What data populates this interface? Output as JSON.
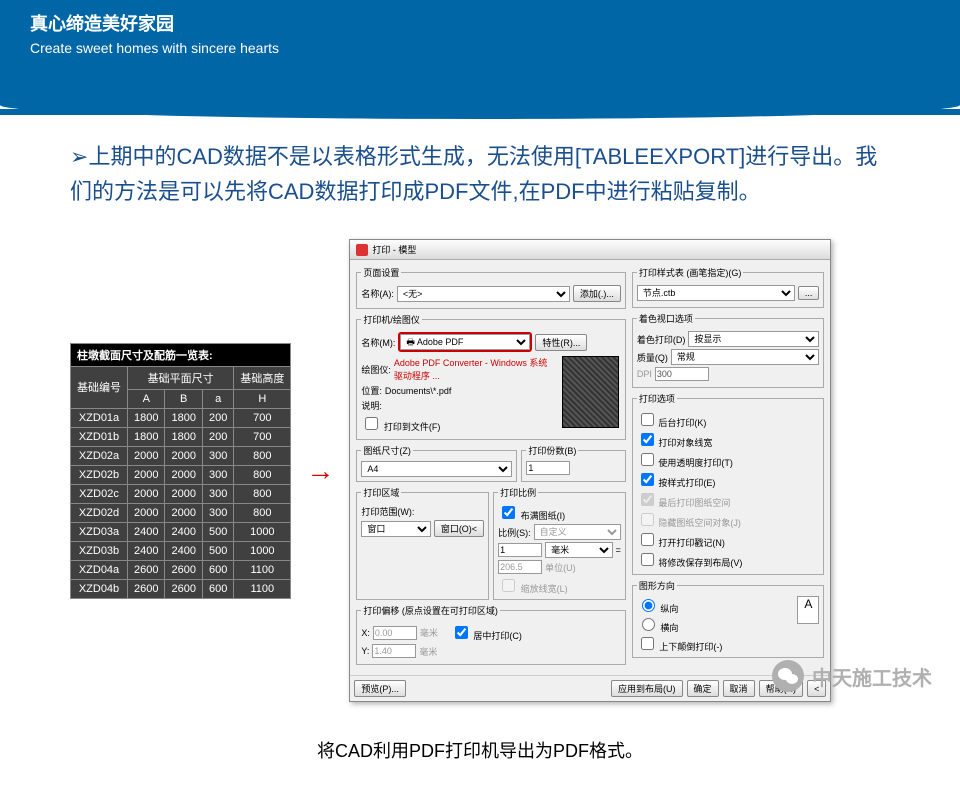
{
  "header": {
    "cn": "真心缔造美好家园",
    "en": "Create sweet homes with sincere hearts"
  },
  "intro": "上期中的CAD数据不是以表格形式生成，无法使用[TABLEEXPORT]进行导出。我们的方法是可以先将CAD数据打印成PDF文件,在PDF中进行粘贴复制。",
  "table": {
    "title": "柱墩截面尺寸及配筋一览表:",
    "h1": "基础编号",
    "h2": "基础平面尺寸",
    "h3": "基础高度",
    "cols": [
      "A",
      "B",
      "a",
      "H"
    ],
    "rows": [
      [
        "XZD01a",
        "1800",
        "1800",
        "200",
        "700"
      ],
      [
        "XZD01b",
        "1800",
        "1800",
        "200",
        "700"
      ],
      [
        "XZD02a",
        "2000",
        "2000",
        "300",
        "800"
      ],
      [
        "XZD02b",
        "2000",
        "2000",
        "300",
        "800"
      ],
      [
        "XZD02c",
        "2000",
        "2000",
        "300",
        "800"
      ],
      [
        "XZD02d",
        "2000",
        "2000",
        "300",
        "800"
      ],
      [
        "XZD03a",
        "2400",
        "2400",
        "500",
        "1000"
      ],
      [
        "XZD03b",
        "2400",
        "2400",
        "500",
        "1000"
      ],
      [
        "XZD04a",
        "2600",
        "2600",
        "600",
        "1100"
      ],
      [
        "XZD04b",
        "2600",
        "2600",
        "600",
        "1100"
      ]
    ]
  },
  "dialog": {
    "title": "打印 - 模型",
    "page_setup": "页面设置",
    "name": "名称(A):",
    "name_val": "<无>",
    "add": "添加(.)...",
    "printer": "打印机/绘图仪",
    "printer_name": "名称(M):",
    "printer_val": "Adobe PDF",
    "props": "特性(R)...",
    "plotter": "绘图仪:",
    "plotter_val": "Adobe PDF Converter - Windows 系统驱动程序 ...",
    "where": "位置:",
    "where_val": "Documents\\*.pdf",
    "desc": "说明:",
    "tofile": "打印到文件(F)",
    "paper": "图纸尺寸(Z)",
    "paper_val": "A4",
    "copies": "打印份数(B)",
    "copies_val": "1",
    "area": "打印区域",
    "area_lbl": "打印范围(W):",
    "area_val": "窗口",
    "area_btn": "窗口(O)<",
    "scale": "打印比例",
    "fit": "布满图纸(I)",
    "scale_lbl": "比例(S):",
    "scale_val": "自定义",
    "mm": "毫米",
    "unit": "单位(U)",
    "lw": "缩放线宽(L)",
    "u1": "1",
    "u2": "206.5",
    "offset": "打印偏移 (原点设置在可打印区域)",
    "x": "X:",
    "xval": "0.00",
    "y": "Y:",
    "yval": "1.40",
    "off_unit": "毫米",
    "center": "居中打印(C)",
    "style": "打印样式表 (画笔指定)(G)",
    "style_val": "节点.ctb",
    "viewport": "着色视口选项",
    "shade": "着色打印(D)",
    "shade_val": "按显示",
    "quality": "质量(Q)",
    "quality_val": "常规",
    "dpi": "DPI",
    "dpi_val": "300",
    "options": "打印选项",
    "opt1": "后台打印(K)",
    "opt2": "打印对象线宽",
    "opt3": "使用透明度打印(T)",
    "opt4": "按样式打印(E)",
    "opt5": "最后打印图纸空间",
    "opt6": "隐藏图纸空间对象(J)",
    "opt7": "打开打印戳记(N)",
    "opt8": "将修改保存到布局(V)",
    "orient": "图形方向",
    "portrait": "纵向",
    "landscape": "横向",
    "upside": "上下颠倒打印(-)",
    "preview": "预览(P)...",
    "apply": "应用到布局(U)",
    "ok": "确定",
    "cancel": "取消",
    "help": "帮助(H)"
  },
  "caption": "将CAD利用PDF打印机导出为PDF格式。",
  "wechat": "中天施工技术"
}
